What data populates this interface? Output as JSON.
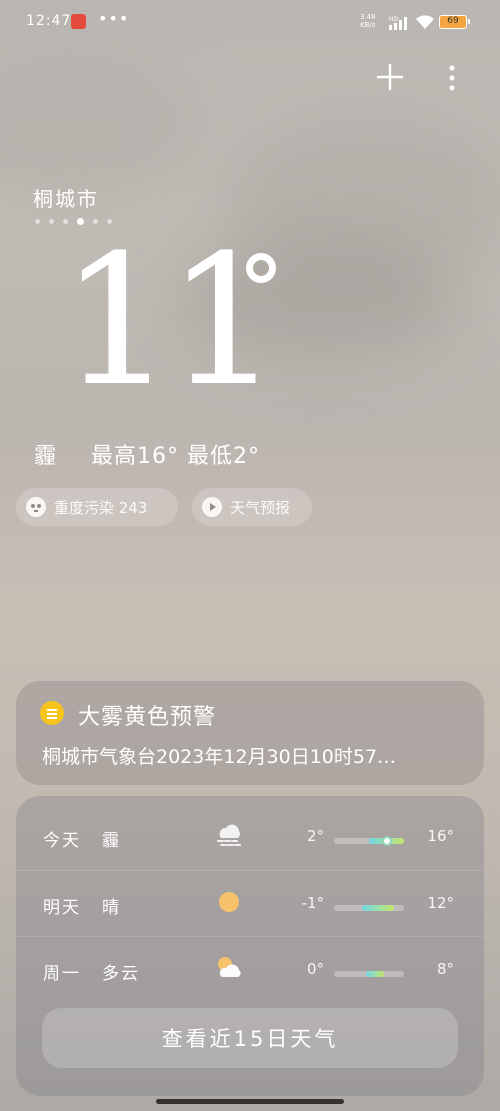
{
  "status_bar": {
    "time": "12:47",
    "more": "•••",
    "net_speed_value": "3.48",
    "net_speed_unit": "KB/s",
    "network_type": "HD",
    "battery": "69"
  },
  "header": {
    "city": "桐城市",
    "page_count": 6,
    "active_page": 4
  },
  "current": {
    "temperature": "11"
  },
  "summary": {
    "condition": "霾",
    "high_label": "最高16°",
    "low_label": "最低2°"
  },
  "pills": {
    "aqi": "重度污染 243",
    "report": "天气预报"
  },
  "alert": {
    "title": "大雾黄色预警",
    "text": "桐城市气象台2023年12月30日10时57…",
    "color": "#f6c41d"
  },
  "forecast": [
    {
      "day": "今天",
      "condition": "霾",
      "icon": "haze-icon",
      "low": "2°",
      "high": "16°",
      "bar_start": 0.5,
      "bar_end": 1.0,
      "current_position": 0.75
    },
    {
      "day": "明天",
      "condition": "晴",
      "icon": "sun-icon",
      "low": "-1°",
      "high": "12°",
      "bar_start": 0.4,
      "bar_end": 0.85
    },
    {
      "day": "周一",
      "condition": "多云",
      "icon": "partly-cloudy-icon",
      "low": "0°",
      "high": "8°",
      "bar_start": 0.45,
      "bar_end": 0.72
    }
  ],
  "cta": "查看近15日天气",
  "colors": {
    "accent_sun": "#f6c26b",
    "bar_gradient_start": "#6fd7e8",
    "bar_gradient_end": "#c6e66c"
  }
}
